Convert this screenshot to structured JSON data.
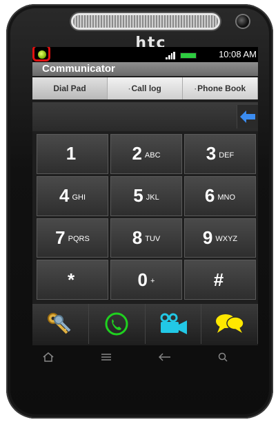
{
  "device": {
    "brand": "htc"
  },
  "status": {
    "time": "10:08 AM"
  },
  "app": {
    "title": "Communicator"
  },
  "tabs": [
    {
      "label": "Dial Pad",
      "active": true
    },
    {
      "label": "Call log",
      "active": false
    },
    {
      "label": "Phone Book",
      "active": false
    }
  ],
  "dialer": {
    "entered_number": ""
  },
  "keys": [
    {
      "digit": "1",
      "letters": ""
    },
    {
      "digit": "2",
      "letters": "ABC"
    },
    {
      "digit": "3",
      "letters": "DEF"
    },
    {
      "digit": "4",
      "letters": "GHI"
    },
    {
      "digit": "5",
      "letters": "JKL"
    },
    {
      "digit": "6",
      "letters": "MNO"
    },
    {
      "digit": "7",
      "letters": "PQRS"
    },
    {
      "digit": "8",
      "letters": "TUV"
    },
    {
      "digit": "9",
      "letters": "WXYZ"
    },
    {
      "digit": "*",
      "letters": ""
    },
    {
      "digit": "0",
      "letters": "+"
    },
    {
      "digit": "#",
      "letters": ""
    }
  ],
  "actions": [
    {
      "icon": "keys-icon"
    },
    {
      "icon": "phone-call-icon"
    },
    {
      "icon": "video-call-icon"
    },
    {
      "icon": "chat-bubbles-icon"
    }
  ],
  "colors": {
    "highlight_ring": "#e01010",
    "call_green": "#1fd11f",
    "video_cyan": "#22c8e6",
    "chat_yellow": "#ffe800"
  }
}
